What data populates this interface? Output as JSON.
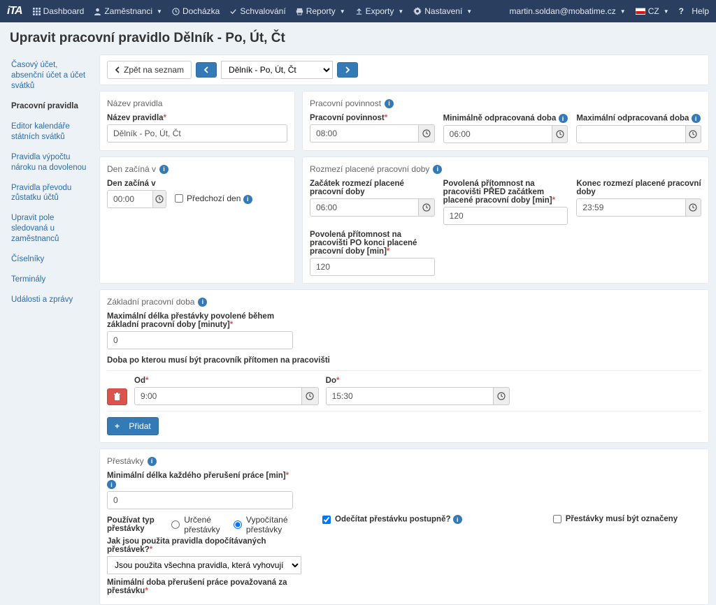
{
  "topbar": {
    "logo": "iTA",
    "nav": [
      "Dashboard",
      "Zaměstnanci",
      "Docházka",
      "Schvalování",
      "Reporty",
      "Exporty",
      "Nastavení"
    ],
    "user": "martin.soldan@mobatime.cz",
    "lang": "CZ",
    "help": "Help"
  },
  "page_title": "Upravit pracovní pravidlo Dělník - Po, Út, Čt",
  "sidebar": [
    "Časový účet, absenční účet a účet svátků",
    "Pracovní pravidla",
    "Editor kalendáře státních svátků",
    "Pravidla výpočtu nároku na dovolenou",
    "Pravidla převodu zůstatku účtů",
    "Upravit pole sledovaná u zaměstnanců",
    "Číselníky",
    "Terminály",
    "Události a zprávy"
  ],
  "sidebar_active": 1,
  "toolbar": {
    "back": "Zpět na seznam",
    "selected": "Dělník - Po, Út, Čt"
  },
  "s_name": {
    "title": "Název pravidla",
    "label": "Název pravidla",
    "value": "Dělník - Po, Út, Čt"
  },
  "s_oblig": {
    "title": "Pracovní povinnost",
    "f1": {
      "label": "Pracovní povinnost",
      "value": "08:00"
    },
    "f2": {
      "label": "Minimálně odpracovaná doba",
      "value": "06:00"
    },
    "f3": {
      "label": "Maximální odpracovaná doba",
      "value": ""
    }
  },
  "s_day": {
    "title": "Den začíná v",
    "label": "Den začíná v",
    "value": "00:00",
    "chk": "Předchozí den"
  },
  "s_range": {
    "title": "Rozmezí placené pracovní doby",
    "f1": {
      "label": "Začátek rozmezí placené pracovní doby",
      "value": "06:00"
    },
    "f2": {
      "label": "Povolená přítomnost na pracovišti PŘED začátkem placené pracovní doby [min]",
      "value": "120"
    },
    "f3": {
      "label": "Konec rozmezí placené pracovní doby",
      "value": "23:59"
    },
    "f4": {
      "label": "Povolená přítomnost na pracovišti PO konci placené pracovní doby [min]",
      "value": "120"
    }
  },
  "s_core": {
    "title": "Základní pracovní doba",
    "f1": {
      "label": "Maximální délka přestávky povolené během základní pracovní doby [minuty]",
      "value": "0"
    },
    "head": "Doba po kterou musí být pracovník přítomen na pracovišti",
    "od": "Od",
    "do": "Do",
    "row": {
      "od": "9:00",
      "do": "15:30"
    },
    "add": "Přidat"
  },
  "s_break": {
    "title": "Přestávky",
    "f1": {
      "label": "Minimální délka každého přerušení práce [min]",
      "value": "0"
    },
    "type_label": "Používat typ přestávky",
    "type_opt1": "Určené přestávky",
    "type_opt2": "Vypočítané přestávky",
    "rules_label": "Jak jsou použita pravidla dopočítávaných přestávek?",
    "rules_value": "Jsou použita všechna pravidla, která vyhovují odpracovanému času",
    "chk1": "Odečítat přestávku postupně?",
    "chk2": "Přestávky musí být označeny",
    "f2": "Minimální doba přerušení práce považovaná za přestávku"
  }
}
